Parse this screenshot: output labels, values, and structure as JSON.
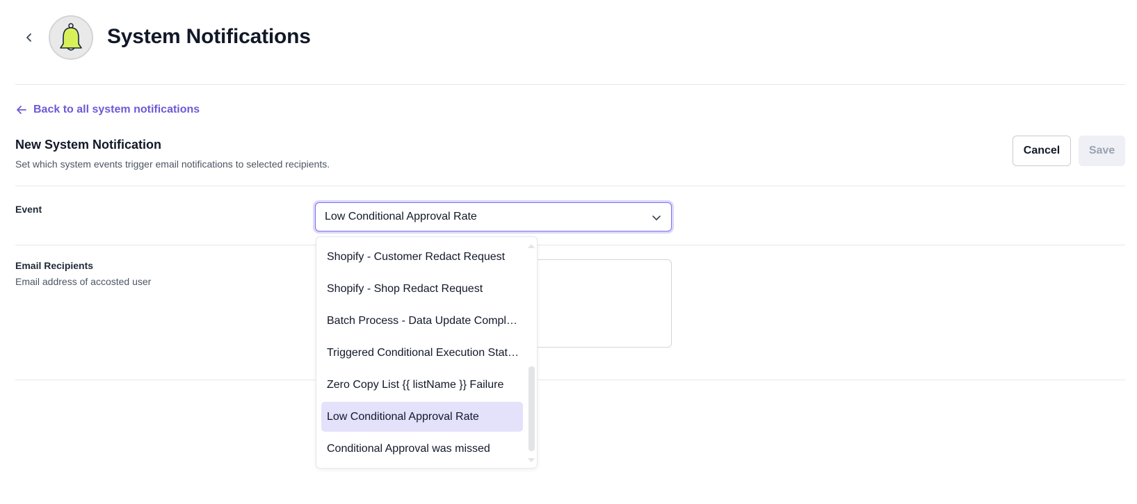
{
  "header": {
    "title": "System Notifications",
    "back_icon": "chevron-left-icon",
    "logo_icon": "bell-icon",
    "logo_color": "#d8f15a"
  },
  "back_link": {
    "label": "Back to all system notifications",
    "icon": "arrow-left-icon",
    "color": "#6d5ad6"
  },
  "form": {
    "title": "New System Notification",
    "subtitle": "Set which system events trigger email notifications to selected recipients.",
    "cancel_label": "Cancel",
    "save_label": "Save"
  },
  "event": {
    "label": "Event",
    "selected_value": "Low Conditional Approval Rate",
    "options": [
      "Shopify - Customer Redact Request",
      "Shopify - Shop Redact Request",
      "Batch Process - Data Update Compl…",
      "Triggered Conditional Execution Stat…",
      "Zero Copy List {{ listName }} Failure",
      "Low Conditional Approval Rate",
      "Conditional Approval was missed"
    ],
    "selected_index": 5
  },
  "recipients": {
    "label": "Email Recipients",
    "description": "Email address of accosted user"
  },
  "colors": {
    "accent": "#7c6ff0",
    "selected_option_bg": "#e4e1fb"
  }
}
